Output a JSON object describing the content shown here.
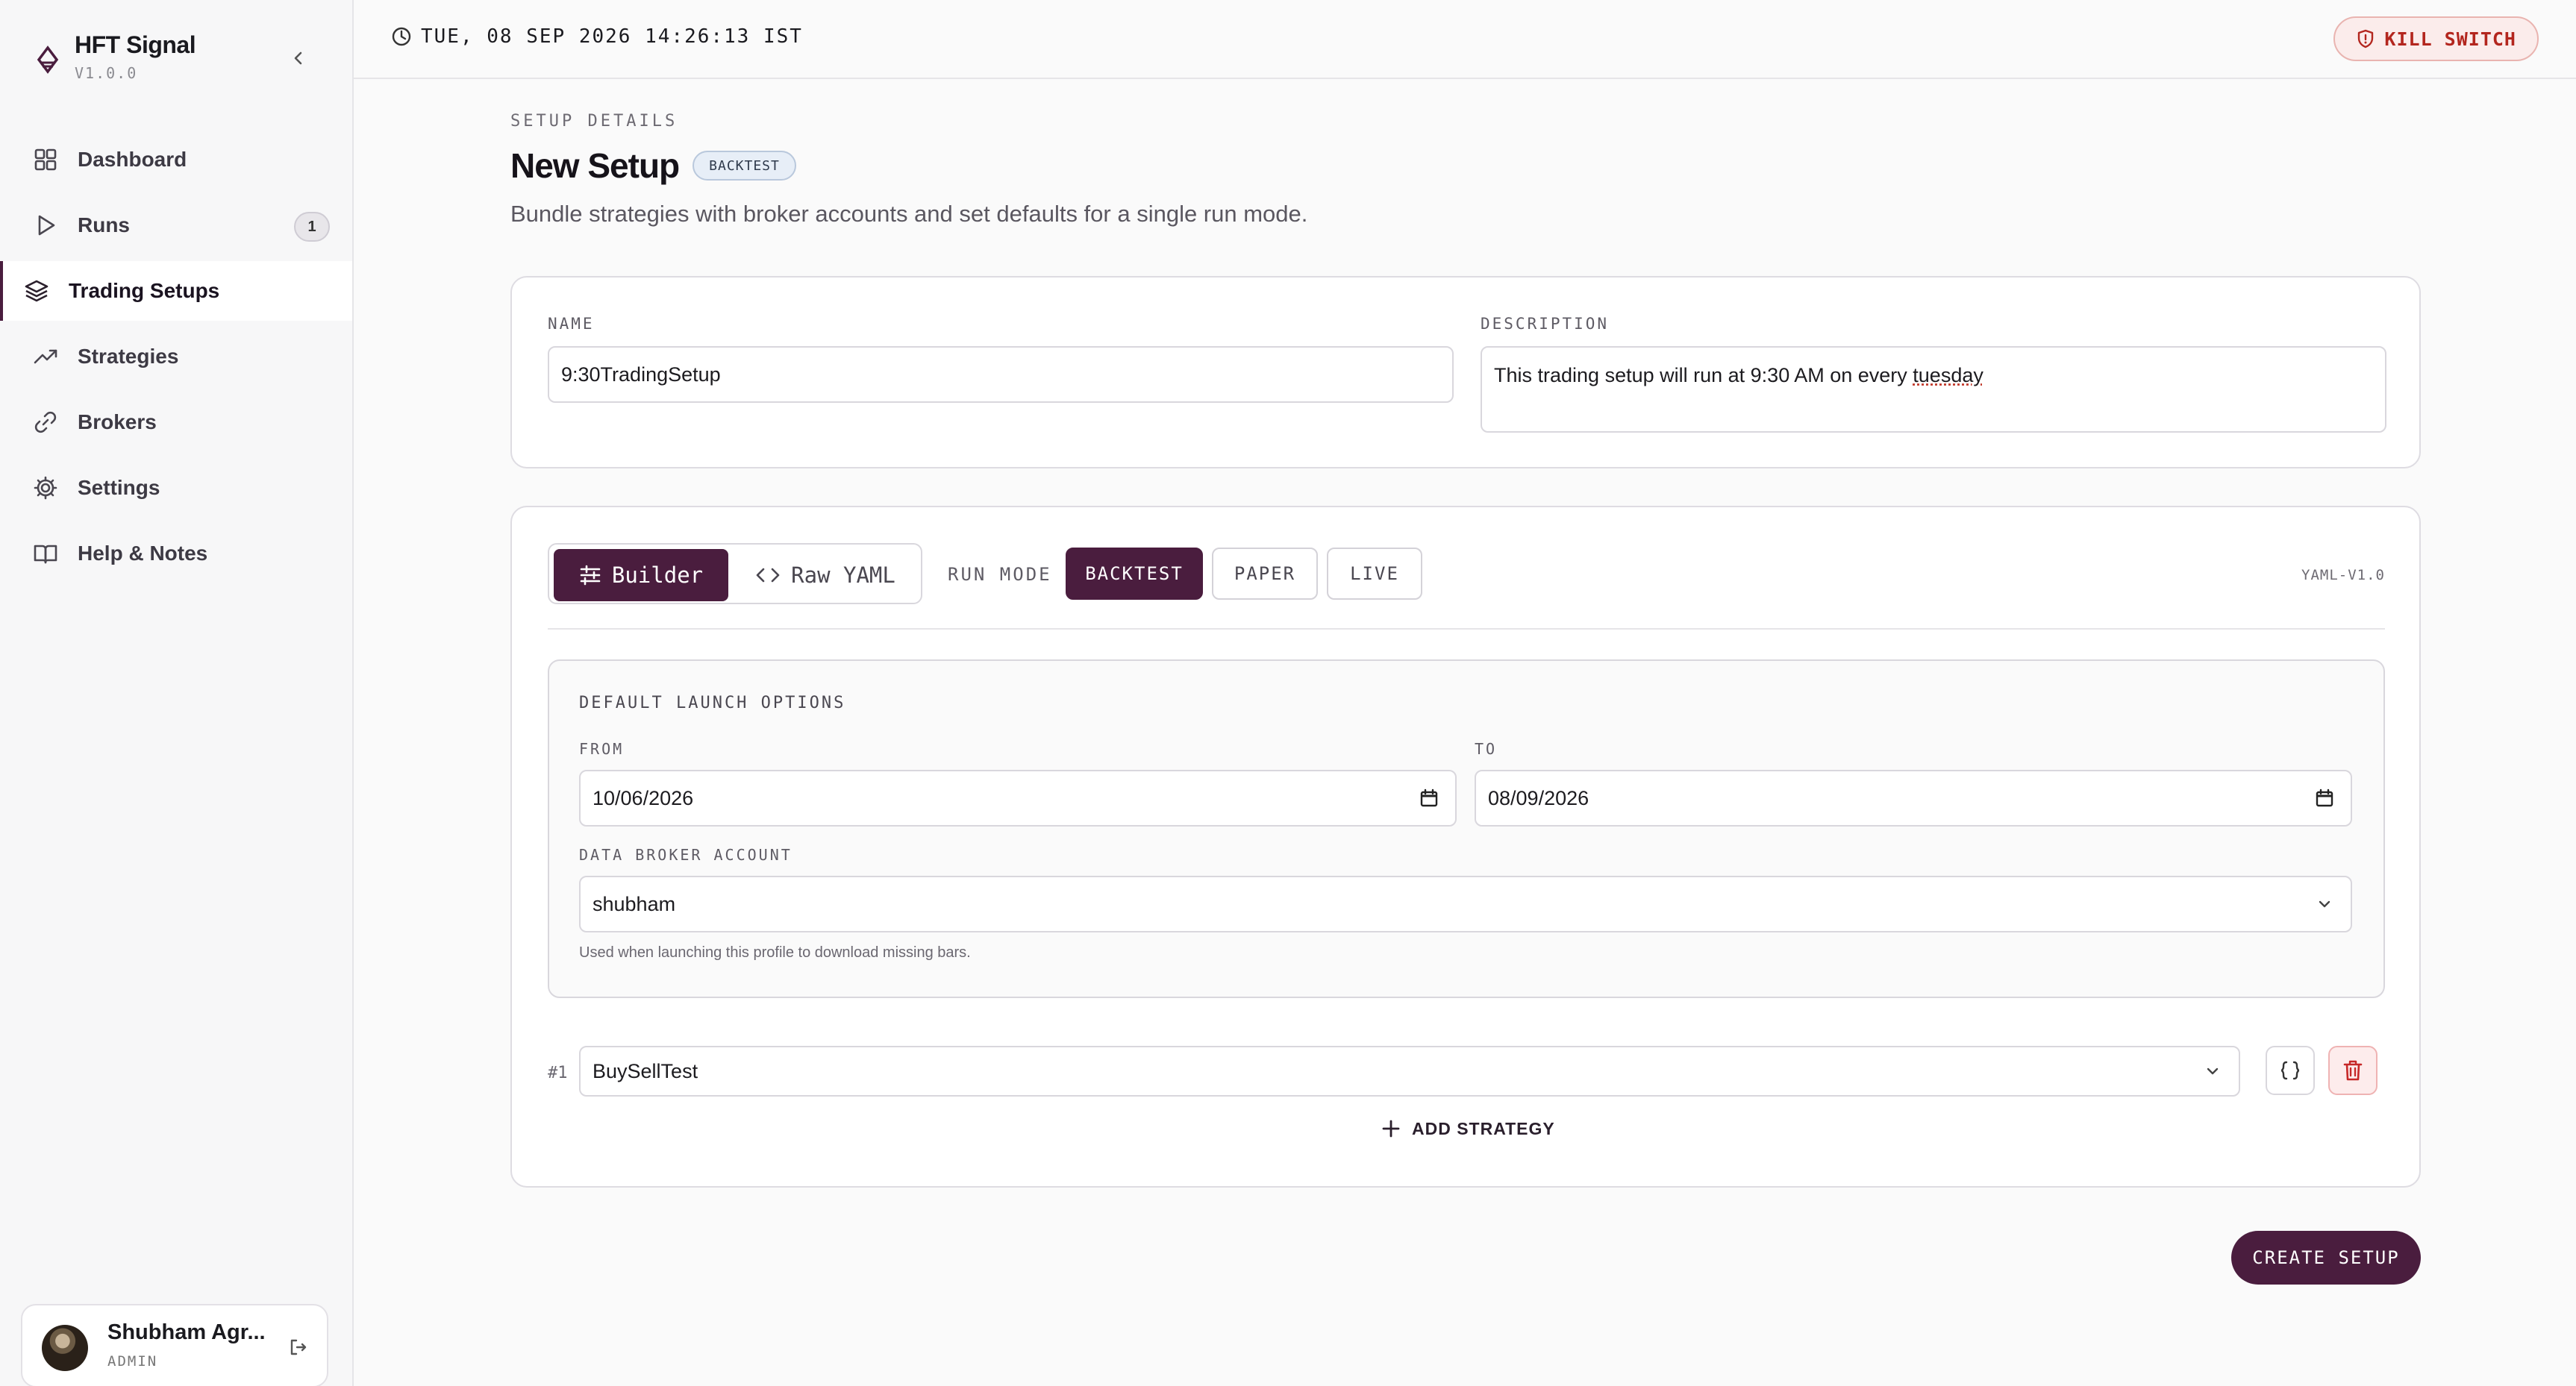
{
  "app": {
    "name": "HFT Signal",
    "version": "V1.0.0"
  },
  "sidebar": {
    "items": [
      {
        "label": "Dashboard",
        "icon": "grid-icon"
      },
      {
        "label": "Runs",
        "icon": "play-icon",
        "badge": "1"
      },
      {
        "label": "Trading Setups",
        "icon": "layers-icon",
        "active": true
      },
      {
        "label": "Strategies",
        "icon": "trending-up-icon"
      },
      {
        "label": "Brokers",
        "icon": "link-icon"
      },
      {
        "label": "Settings",
        "icon": "gear-icon"
      },
      {
        "label": "Help & Notes",
        "icon": "book-icon"
      }
    ],
    "user": {
      "name": "Shubham Agr...",
      "role": "ADMIN"
    }
  },
  "topbar": {
    "datetime": "TUE, 08 SEP 2026 14:26:13 IST",
    "kill_switch": "KILL SWITCH"
  },
  "page": {
    "eyebrow": "SETUP DETAILS",
    "title": "New Setup",
    "mode_badge": "BACKTEST",
    "subtitle": "Bundle strategies with broker accounts and set defaults for a single run mode."
  },
  "form": {
    "name_label": "NAME",
    "name_value": "9:30TradingSetup",
    "description_label": "DESCRIPTION",
    "description_value_prefix": "This trading setup will run at 9:30 AM on every ",
    "description_value_word": "tuesday"
  },
  "editor": {
    "builder_label": "Builder",
    "raw_yaml_label": "Raw YAML",
    "run_mode_label": "RUN MODE",
    "modes": [
      "BACKTEST",
      "PAPER",
      "LIVE"
    ],
    "active_mode": "BACKTEST",
    "yaml_version": "YAML-V1.0"
  },
  "launch_options": {
    "title": "DEFAULT LAUNCH OPTIONS",
    "from_label": "FROM",
    "from_value": "10/06/2026",
    "to_label": "TO",
    "to_value": "08/09/2026",
    "broker_label": "DATA BROKER ACCOUNT",
    "broker_value": "shubham",
    "hint": "Used when launching this profile to download missing bars."
  },
  "strategies": {
    "rows": [
      {
        "index": "#1",
        "value": "BuySellTest"
      }
    ],
    "add_label": "ADD STRATEGY"
  },
  "actions": {
    "create_label": "CREATE SETUP"
  },
  "colors": {
    "accent": "#4a1d3e",
    "danger": "#b3261e",
    "background": "#fafafa"
  }
}
